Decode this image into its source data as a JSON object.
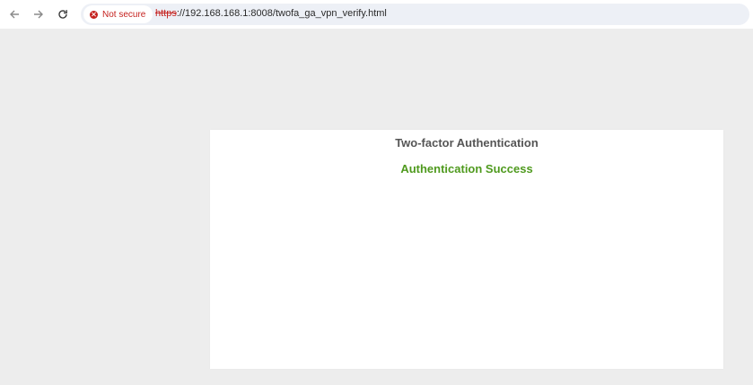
{
  "browser": {
    "security_label": "Not secure",
    "url_scheme": "https",
    "url_rest": "://192.168.168.1:8008/twofa_ga_vpn_verify.html",
    "icons": {
      "back": "arrow-left-icon",
      "forward": "arrow-right-icon",
      "reload": "reload-icon",
      "security": "warning-circle-icon"
    },
    "colors": {
      "not_secure": "#c5221f",
      "omnibox_bg": "#edf0f6"
    }
  },
  "page": {
    "title": "Two-factor Authentication",
    "status": "Authentication Success",
    "colors": {
      "background": "#ededed",
      "title": "#555555",
      "status": "#4f9a1e"
    }
  }
}
